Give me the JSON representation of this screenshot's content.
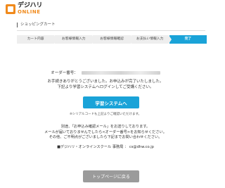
{
  "brand": {
    "name": "デジハリ",
    "sub": "ONLINE"
  },
  "page": {
    "title": "ショッピングカート"
  },
  "steps": [
    "カート内容",
    "お客様情報入力",
    "お客様情報確認",
    "お支払い情報入力",
    "完了"
  ],
  "active_step_index": 4,
  "order": {
    "label": "オーダー番号："
  },
  "messages": {
    "thanks_line1": "お手続きありがとうございました。お申込みが完了いたしました。",
    "thanks_line2": "下記より学習システムへログインしてご受講ください。",
    "learn_button": "学習システムへ",
    "serial_note": "※シリアルコードも上記よりご確認いただけます。",
    "mail_line1": "別途、「お申込み確認メール」をお送りしております。",
    "mail_line2": "メールが届いておりませんでしたら<オーダー番号>をお知らせください。",
    "mail_line3": "その他、ご不明点がございましたら下記までお問い合わせください。",
    "contact": "■デジハリ・オンラインスクール 事務局 ： cs@dhw.co.jp",
    "top_button": "トップページに戻る"
  },
  "colors": {
    "accent": "#1aa3d8",
    "brand_orange": "#f08a1c",
    "disabled_button": "#9b9b9b"
  }
}
